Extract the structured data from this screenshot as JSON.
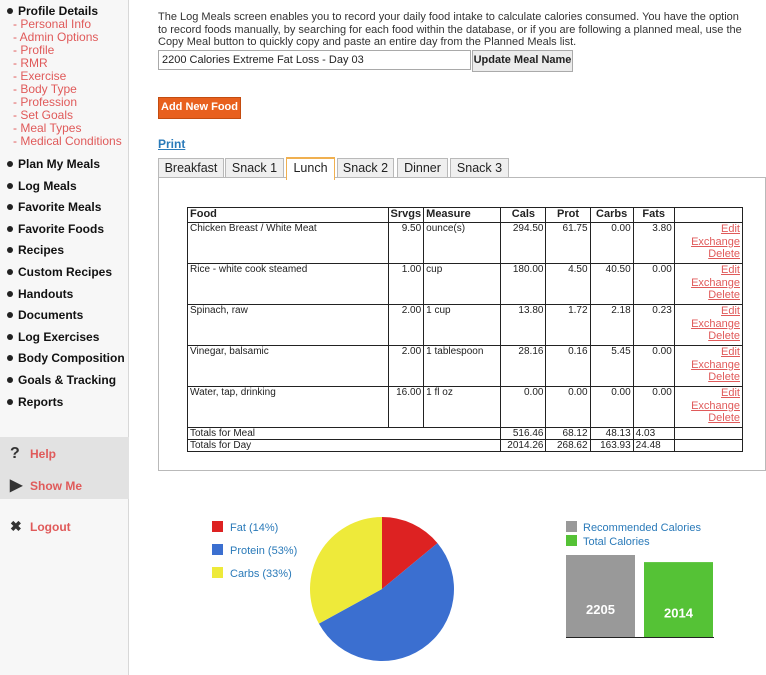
{
  "sidebar": {
    "profile_title": "Profile Details",
    "profile_links": [
      "- Personal Info",
      "- Admin Options",
      "- Profile",
      "- RMR",
      "- Exercise",
      "- Body Type",
      "- Profession",
      "- Set Goals",
      "- Meal Types",
      "- Medical Conditions"
    ],
    "nav": [
      "Plan My Meals",
      "Log Meals",
      "Favorite Meals",
      "Favorite Foods",
      "Recipes",
      "Custom Recipes",
      "Handouts",
      "Documents",
      "Log Exercises",
      "Body Composition",
      "Goals & Tracking",
      "Reports"
    ],
    "help": "Help",
    "show_me": "Show Me",
    "logout": "Logout"
  },
  "main": {
    "intro": "The Log Meals screen enables you to record your daily food intake to calculate calories consumed. You have the option to record foods manually, by searching for each food within the database, or if you are following a planned meal, use the Copy Meal button to quickly copy and paste an entire day from the Planned Meals list.",
    "meal_name": "2200 Calories Extreme Fat Loss - Day 03",
    "update_button": "Update Meal Name",
    "add_food_button": "Add New Food",
    "print_link": "Print",
    "tabs": [
      "Breakfast",
      "Snack 1",
      "Lunch",
      "Snack 2",
      "Dinner",
      "Snack 3"
    ],
    "active_tab": "Lunch"
  },
  "table": {
    "headers": [
      "Food",
      "Srvgs",
      "Measure",
      "Cals",
      "Prot",
      "Carbs",
      "Fats",
      ""
    ],
    "rows": [
      {
        "food": "Chicken Breast / White Meat",
        "srvgs": "9.50",
        "measure": "ounce(s)",
        "cals": "294.50",
        "prot": "61.75",
        "carbs": "0.00",
        "fats": "3.80"
      },
      {
        "food": "Rice - white cook steamed",
        "srvgs": "1.00",
        "measure": "cup",
        "cals": "180.00",
        "prot": "4.50",
        "carbs": "40.50",
        "fats": "0.00"
      },
      {
        "food": "Spinach, raw",
        "srvgs": "2.00",
        "measure": "1 cup",
        "cals": "13.80",
        "prot": "1.72",
        "carbs": "2.18",
        "fats": "0.23"
      },
      {
        "food": "Vinegar, balsamic",
        "srvgs": "2.00",
        "measure": "1 tablespoon",
        "cals": "28.16",
        "prot": "0.16",
        "carbs": "5.45",
        "fats": "0.00"
      },
      {
        "food": "Water, tap, drinking",
        "srvgs": "16.00",
        "measure": "1 fl oz",
        "cals": "0.00",
        "prot": "0.00",
        "carbs": "0.00",
        "fats": "0.00"
      }
    ],
    "actions": {
      "edit": "Edit",
      "exchange": "Exchange",
      "delete": "Delete"
    },
    "totals_meal": {
      "label": "Totals for Meal",
      "cals": "516.46",
      "prot": "68.12",
      "carbs": "48.13",
      "fats": "4.03"
    },
    "totals_day": {
      "label": "Totals for Day",
      "cals": "2014.26",
      "prot": "268.62",
      "carbs": "163.93",
      "fats": "24.48"
    }
  },
  "colors": {
    "fat": "#dd2222",
    "protein": "#3b6fd0",
    "carbs": "#eeea3a",
    "recommended": "#999999",
    "total": "#55c236",
    "accent": "#e8601e",
    "link": "#2a7ab9"
  },
  "chart_data": [
    {
      "type": "pie",
      "labels": [
        "Fat (14%)",
        "Protein (53%)",
        "Carbs (33%)"
      ],
      "values": [
        14,
        53,
        33
      ]
    },
    {
      "type": "bar",
      "categories": [
        "Recommended Calories",
        "Total Calories"
      ],
      "values": [
        2205,
        2014
      ],
      "data_labels": [
        "2205",
        "2014"
      ]
    }
  ]
}
